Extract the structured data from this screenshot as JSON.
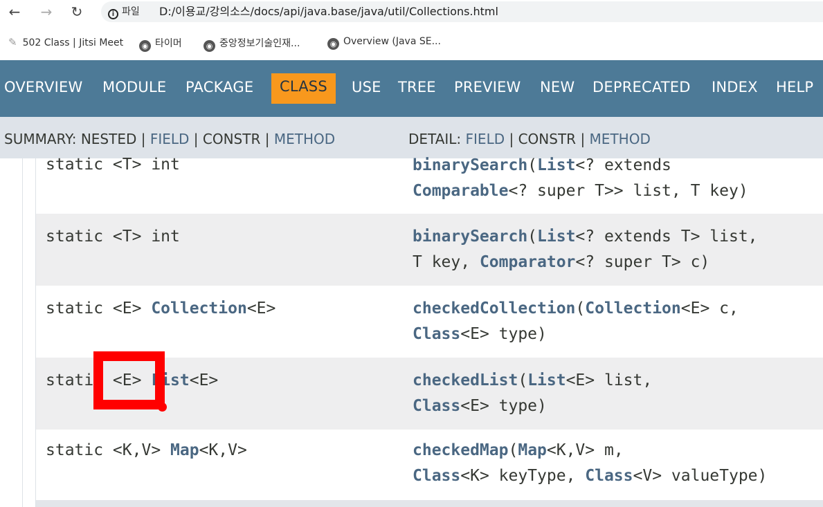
{
  "browser": {
    "site_label": "파일",
    "url": "D:/이용교/강의소스/docs/api/java.base/java/util/Collections.html",
    "bookmarks": [
      {
        "label": "502 Class | Jitsi Meet",
        "icon": "pen-icon"
      },
      {
        "label": "타이머",
        "icon": "globe-icon"
      },
      {
        "label": "중앙정보기술인재...",
        "icon": "globe-icon"
      },
      {
        "label": "Overview (Java SE...",
        "icon": "globe-icon"
      }
    ]
  },
  "nav": {
    "items": [
      "OVERVIEW",
      "MODULE",
      "PACKAGE",
      "CLASS",
      "USE",
      "TREE",
      "PREVIEW",
      "NEW",
      "DEPRECATED",
      "INDEX",
      "HELP"
    ],
    "active": "CLASS"
  },
  "subnav": {
    "summary_label": "SUMMARY:",
    "summary_nested": "NESTED",
    "summary_field": "FIELD",
    "summary_constr": "CONSTR",
    "summary_method": "METHOD",
    "detail_label": "DETAIL:",
    "detail_field": "FIELD",
    "detail_constr": "CONSTR",
    "detail_method": "METHOD",
    "sep": "|"
  },
  "rows": [
    {
      "mod": [
        "static <T> int"
      ],
      "sig1": [
        "binarySearch",
        "(",
        "List",
        "<? extends"
      ],
      "sig2": [
        "Comparable",
        "<? super T>> list, T key)"
      ]
    },
    {
      "mod": [
        "static <T> int"
      ],
      "sig1": [
        "binarySearch",
        "(",
        "List",
        "<? extends T> list,"
      ],
      "sig2": [
        "T key, ",
        "Comparator",
        "<? super T> c)"
      ]
    },
    {
      "mod": [
        "static <E> ",
        "Collection",
        "<E>"
      ],
      "sig1": [
        "checkedCollection",
        "(",
        "Collection",
        "<E> c,"
      ],
      "sig2": [
        "Class",
        "<E> type)"
      ]
    },
    {
      "mod": [
        "static <E> ",
        "List",
        "<E>"
      ],
      "sig1": [
        "checkedList",
        "(",
        "List",
        "<E> list,"
      ],
      "sig2": [
        "Class",
        "<E> type)"
      ]
    },
    {
      "mod": [
        "static <K,V> ",
        "Map",
        "<K,V>"
      ],
      "sig1": [
        "checkedMap",
        "(",
        "Map",
        "<K,V> m,"
      ],
      "sig2": [
        "Class",
        "<K> keyType, ",
        "Class",
        "<V> valueType)"
      ]
    }
  ],
  "colors": {
    "nav_bg": "#4d7a97",
    "nav_active": "#f8981d",
    "subnav_bg": "#dee3e9",
    "link": "#4a6782",
    "highlight": "#ff0000"
  }
}
